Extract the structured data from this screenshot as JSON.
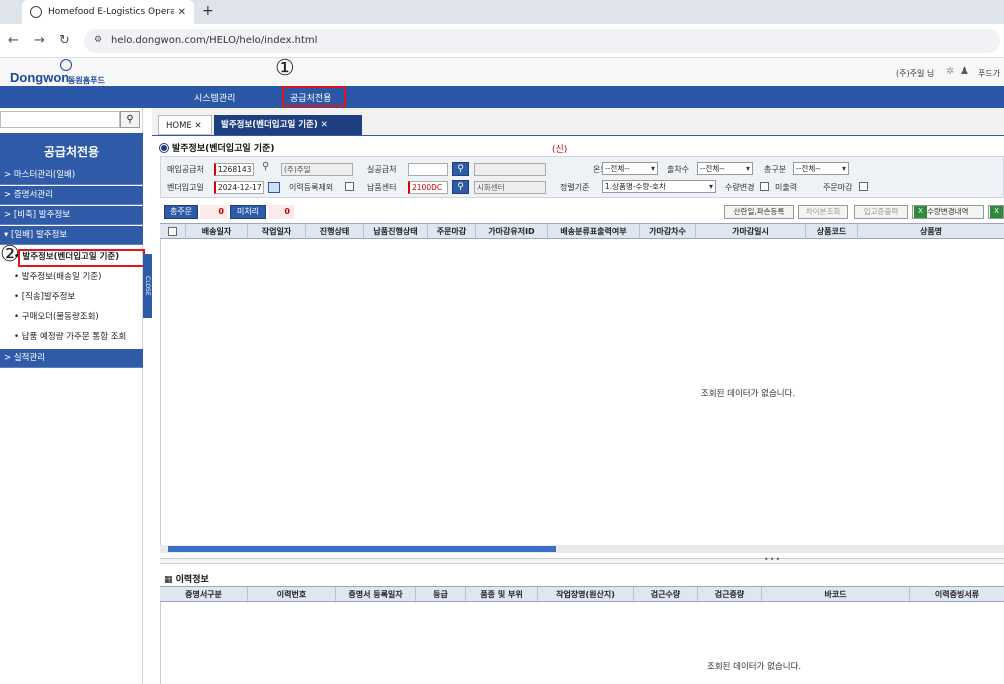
{
  "browser": {
    "tab_title": "Homefood E-Logistics Operatio",
    "tab_close": "✕",
    "new_tab": "+",
    "url": "helo.dongwon.com/HELO/helo/index.html",
    "nav_back": "←",
    "nav_forward": "→",
    "nav_reload": "↻"
  },
  "header": {
    "logo_text": "Dongwon",
    "logo_kr": "동원홈푸드",
    "user_text": "(주)주일 님",
    "user_text2": "푸드가"
  },
  "topnav": {
    "items": [
      "시스템관리",
      "공급처전용"
    ]
  },
  "annotations": {
    "one": "①",
    "two": "②"
  },
  "sidebar": {
    "title": "공급처전용",
    "menus": [
      "> 마스터관리(일배)",
      "> 증명서관리",
      "> [비축] 발주정보",
      "▾ [일배] 발주정보"
    ],
    "submenu": [
      "• 발주정보(벤더입고일 기준)",
      "• 발주정보(배송일 기준)",
      "• [직송]발주정보",
      "• 구매오더(물동량조회)",
      "• 납품 예정량 가주문 통합 조회"
    ],
    "menu_last": "> 실적관리",
    "close_label": "CLOSE"
  },
  "main": {
    "tabs": [
      {
        "label": "HOME  ✕"
      },
      {
        "label": "발주정보(벤더입고일 기준)  ✕"
      }
    ],
    "page_title": "발주정보(벤더입고일 기준)",
    "mark": "(신)"
  },
  "form": {
    "l_supplier": "매입공급처",
    "supplier_code": "1268143",
    "supplier_name": "(주)주일",
    "l_real": "실공급처",
    "real_code": "",
    "real_name": "",
    "l_temp": "온도",
    "temp_value": "--전체--",
    "l_order_seq": "출차수",
    "order_seq_value": "--전체--",
    "l_order_div": "총구분",
    "order_div_value": "--전체--",
    "l_vendor_date": "벤더입고일",
    "vendor_date": "2024-12-17",
    "l_hist_except": "이력등록제외",
    "l_center": "납품센터",
    "center_code": "2100DC",
    "center_name": "시화센터",
    "l_sort": "정렬기준",
    "sort_value": "1.상품명-수량-호차",
    "l_qty_change": "수량변경",
    "l_undelivered": "미출력",
    "l_order_close": "주문마감"
  },
  "counters": {
    "total_label": "총주문",
    "total_value": "0",
    "unproc_label": "미처리",
    "unproc_value": "0"
  },
  "actions": [
    "산란일,파손등록",
    "차이분조회",
    "입고증출력",
    "수량변경내역"
  ],
  "grid": {
    "headers": [
      "배송일자",
      "작업일자",
      "진행상태",
      "납품진행상태",
      "주문마감",
      "가마감유저ID",
      "배송분류표출력여부",
      "가마감차수",
      "가마감일시",
      "상품코드",
      "상품명"
    ],
    "no_data": "조회된 데이터가 없습니다."
  },
  "history": {
    "title": "이력정보",
    "headers": [
      "증명서구분",
      "이력번호",
      "증명서 등록일자",
      "등급",
      "품종 및 부위",
      "작업장명(원산지)",
      "검근수량",
      "검근중량",
      "바코드",
      "이력증빙서류"
    ],
    "no_data": "조회된 데이터가 없습니다."
  },
  "colors": {
    "accent": "#2e5aa8",
    "annotation_red": "#e2131a"
  }
}
